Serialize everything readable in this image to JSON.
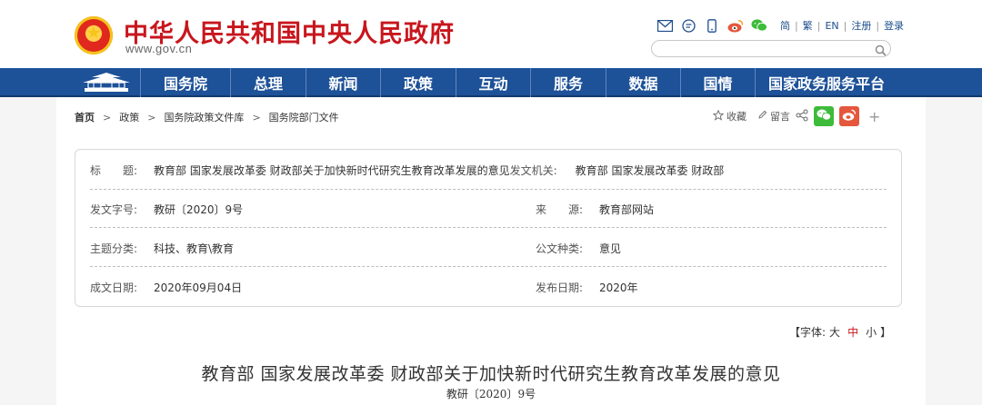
{
  "header": {
    "site_title": "中华人民共和国中央人民政府",
    "site_url": "www.gov.cn",
    "lang_links": [
      "简",
      "繁",
      "EN",
      "注册",
      "登录"
    ],
    "search_placeholder": ""
  },
  "nav": {
    "items": [
      "国务院",
      "总理",
      "新闻",
      "政策",
      "互动",
      "服务",
      "数据",
      "国情",
      "国家政务服务平台"
    ]
  },
  "breadcrumb": [
    "首页",
    "政策",
    "国务院政策文件库",
    "国务院部门文件"
  ],
  "share": {
    "favorite_label": "收藏",
    "comment_label": "留言"
  },
  "info": {
    "title_label": "标　　题:",
    "title_value": "教育部 国家发展改革委 财政部关于加快新时代研究生教育改革发展的意见",
    "issuer_label": "发文机关:",
    "issuer_value": "教育部 国家发展改革委 财政部",
    "doc_no_label": "发文字号:",
    "doc_no_value": "教研〔2020〕9号",
    "source_label": "来　　源:",
    "source_value": "教育部网站",
    "category_label": "主题分类:",
    "category_value": "科技、教育\\教育",
    "doc_type_label": "公文种类:",
    "doc_type_value": "意见",
    "written_label": "成文日期:",
    "written_value": "2020年09月04日",
    "published_label": "发布日期:",
    "published_value": "2020年"
  },
  "font_size": {
    "prefix": "【字体:",
    "options": [
      "大",
      "中",
      "小"
    ],
    "suffix": "】",
    "active": "中"
  },
  "document": {
    "title": "教育部 国家发展改革委 财政部关于加快新时代研究生教育改革发展的意见",
    "number": "教研〔2020〕9号"
  },
  "colors": {
    "brand_red": "#c8161d",
    "nav_blue": "#1d5198",
    "wechat_green": "#3dbb3a",
    "weibo_red": "#e4573d"
  }
}
